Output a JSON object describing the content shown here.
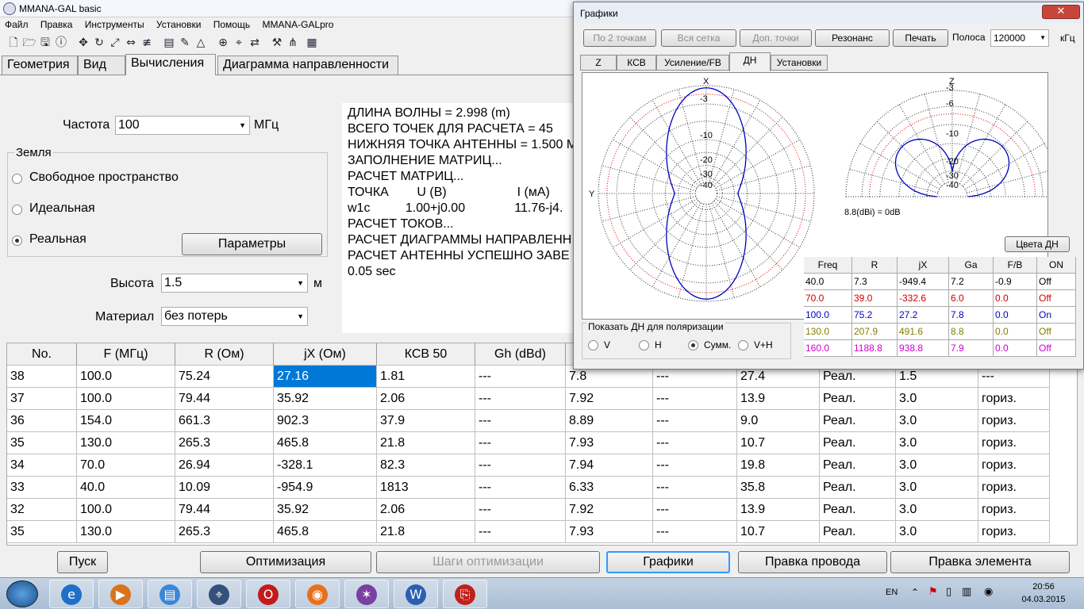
{
  "app": {
    "title": "MMANA-GAL basic"
  },
  "menu": [
    "Файл",
    "Правка",
    "Инструменты",
    "Установки",
    "Помощь",
    "MMANA-GALpro"
  ],
  "main_tabs": [
    "Геометрия",
    "Вид",
    "Вычисления",
    "Диаграмма направленности"
  ],
  "calc": {
    "freq_label": "Частота",
    "freq_value": "100",
    "freq_unit": "МГц",
    "ground_title": "Земля",
    "ground_options": [
      "Свободное пространство",
      "Идеальная",
      "Реальная"
    ],
    "params_button": "Параметры",
    "height_label": "Высота",
    "height_value": "1.5",
    "height_unit": "м",
    "material_label": "Материал",
    "material_value": "без потерь"
  },
  "log": [
    "ДЛИНА ВОЛНЫ = 2.998 (m)",
    "ВСЕГО ТОЧЕК ДЛЯ РАСЧЕТА = 45",
    "НИЖНЯЯ ТОЧКА АНТЕННЫ = 1.500 M",
    "ЗАПОЛНЕНИЕ МАТРИЦ...",
    "РАСЧЕТ МАТРИЦ...",
    "ТОЧКА        U (B)                    I (мA)",
    "w1c          1.00+j0.00              11.76-j4.",
    "РАСЧЕТ ТОКОВ...",
    "РАСЧЕТ ДИАГРАММЫ НАПРАВЛЕНН",
    "РАСЧЕТ АНТЕННЫ УСПЕШНО ЗАВЕ",
    "0.05 sec"
  ],
  "results": {
    "headers": [
      "No.",
      "F (МГц)",
      "R (Ом)",
      "jX (Ом)",
      "КСВ 50",
      "Gh (dBd)",
      "",
      "",
      "",
      "",
      "",
      ""
    ],
    "rows": [
      [
        "38",
        "100.0",
        "75.24",
        "27.16",
        "1.81",
        "---",
        "7.8",
        "---",
        "27.4",
        "Реал.",
        "1.5",
        "---"
      ],
      [
        "37",
        "100.0",
        "79.44",
        "35.92",
        "2.06",
        "---",
        "7.92",
        "---",
        "13.9",
        "Реал.",
        "3.0",
        "гориз."
      ],
      [
        "36",
        "154.0",
        "661.3",
        "902.3",
        "37.9",
        "---",
        "8.89",
        "---",
        "9.0",
        "Реал.",
        "3.0",
        "гориз."
      ],
      [
        "35",
        "130.0",
        "265.3",
        "465.8",
        "21.8",
        "---",
        "7.93",
        "---",
        "10.7",
        "Реал.",
        "3.0",
        "гориз."
      ],
      [
        "34",
        "70.0",
        "26.94",
        "-328.1",
        "82.3",
        "---",
        "7.94",
        "---",
        "19.8",
        "Реал.",
        "3.0",
        "гориз."
      ],
      [
        "33",
        "40.0",
        "10.09",
        "-954.9",
        "1813",
        "---",
        "6.33",
        "---",
        "35.8",
        "Реал.",
        "3.0",
        "гориз."
      ],
      [
        "32",
        "100.0",
        "79.44",
        "35.92",
        "2.06",
        "---",
        "7.92",
        "---",
        "13.9",
        "Реал.",
        "3.0",
        "гориз."
      ],
      [
        "35",
        "130.0",
        "265.3",
        "465.8",
        "21.8",
        "---",
        "7.93",
        "---",
        "10.7",
        "Реал.",
        "3.0",
        "гориз."
      ]
    ]
  },
  "bottom_buttons": [
    "Пуск",
    "Оптимизация",
    "Шаги оптимизации",
    "Графики",
    "Правка провода",
    "Правка элемента"
  ],
  "graphs": {
    "title": "Графики",
    "close": "✕",
    "buttons": [
      "По 2 точкам",
      "Вся сетка",
      "Доп. точки",
      "Резонанс",
      "Печать"
    ],
    "band_label": "Полоса",
    "band_value": "120000",
    "band_unit": "кГц",
    "tabs": [
      "Z",
      "КСВ",
      "Усиление/FB",
      "ДН",
      "Установки"
    ],
    "horiz_labels": {
      "x": "X",
      "y": "Y",
      "rings": [
        "-3",
        "-10",
        "-20",
        "-30",
        "-40"
      ]
    },
    "vert_labels": {
      "z": "Z",
      "x": "X",
      "rings": [
        "-3",
        "-6",
        "-10",
        "-20",
        "-30",
        "-40"
      ]
    },
    "gain_note": "8.8(dBi) = 0dB",
    "colors_button": "Цвета ДН",
    "polarization_title": "Показать ДН для поляризации",
    "polarization_options": [
      "V",
      "H",
      "Сумм.",
      "V+H"
    ],
    "table_headers": [
      "Freq",
      "R",
      "jX",
      "Ga",
      "F/B",
      "ON"
    ],
    "table_rows": [
      {
        "cells": [
          "40.0",
          "7.3",
          "-949.4",
          "7.2",
          "-0.9",
          "Off"
        ],
        "color": "#000000"
      },
      {
        "cells": [
          "70.0",
          "39.0",
          "-332.6",
          "6.0",
          "0.0",
          "Off"
        ],
        "color": "#d00000"
      },
      {
        "cells": [
          "100.0",
          "75.2",
          "27.2",
          "7.8",
          "0.0",
          "On"
        ],
        "color": "#0000c0"
      },
      {
        "cells": [
          "130.0",
          "207.9",
          "491.6",
          "8.8",
          "0.0",
          "Off"
        ],
        "color": "#808000"
      },
      {
        "cells": [
          "160.0",
          "1188.8",
          "938.8",
          "7.9",
          "0.0",
          "Off"
        ],
        "color": "#d000d0"
      }
    ]
  },
  "taskbar": {
    "lang": "EN",
    "time": "20:56",
    "date": "04.03.2015",
    "apps": [
      "ie-icon",
      "media-player-icon",
      "folder-icon",
      "mmana-icon",
      "opera-icon",
      "firefox-icon",
      "antenna-icon",
      "word-icon",
      "pdf-icon"
    ]
  }
}
